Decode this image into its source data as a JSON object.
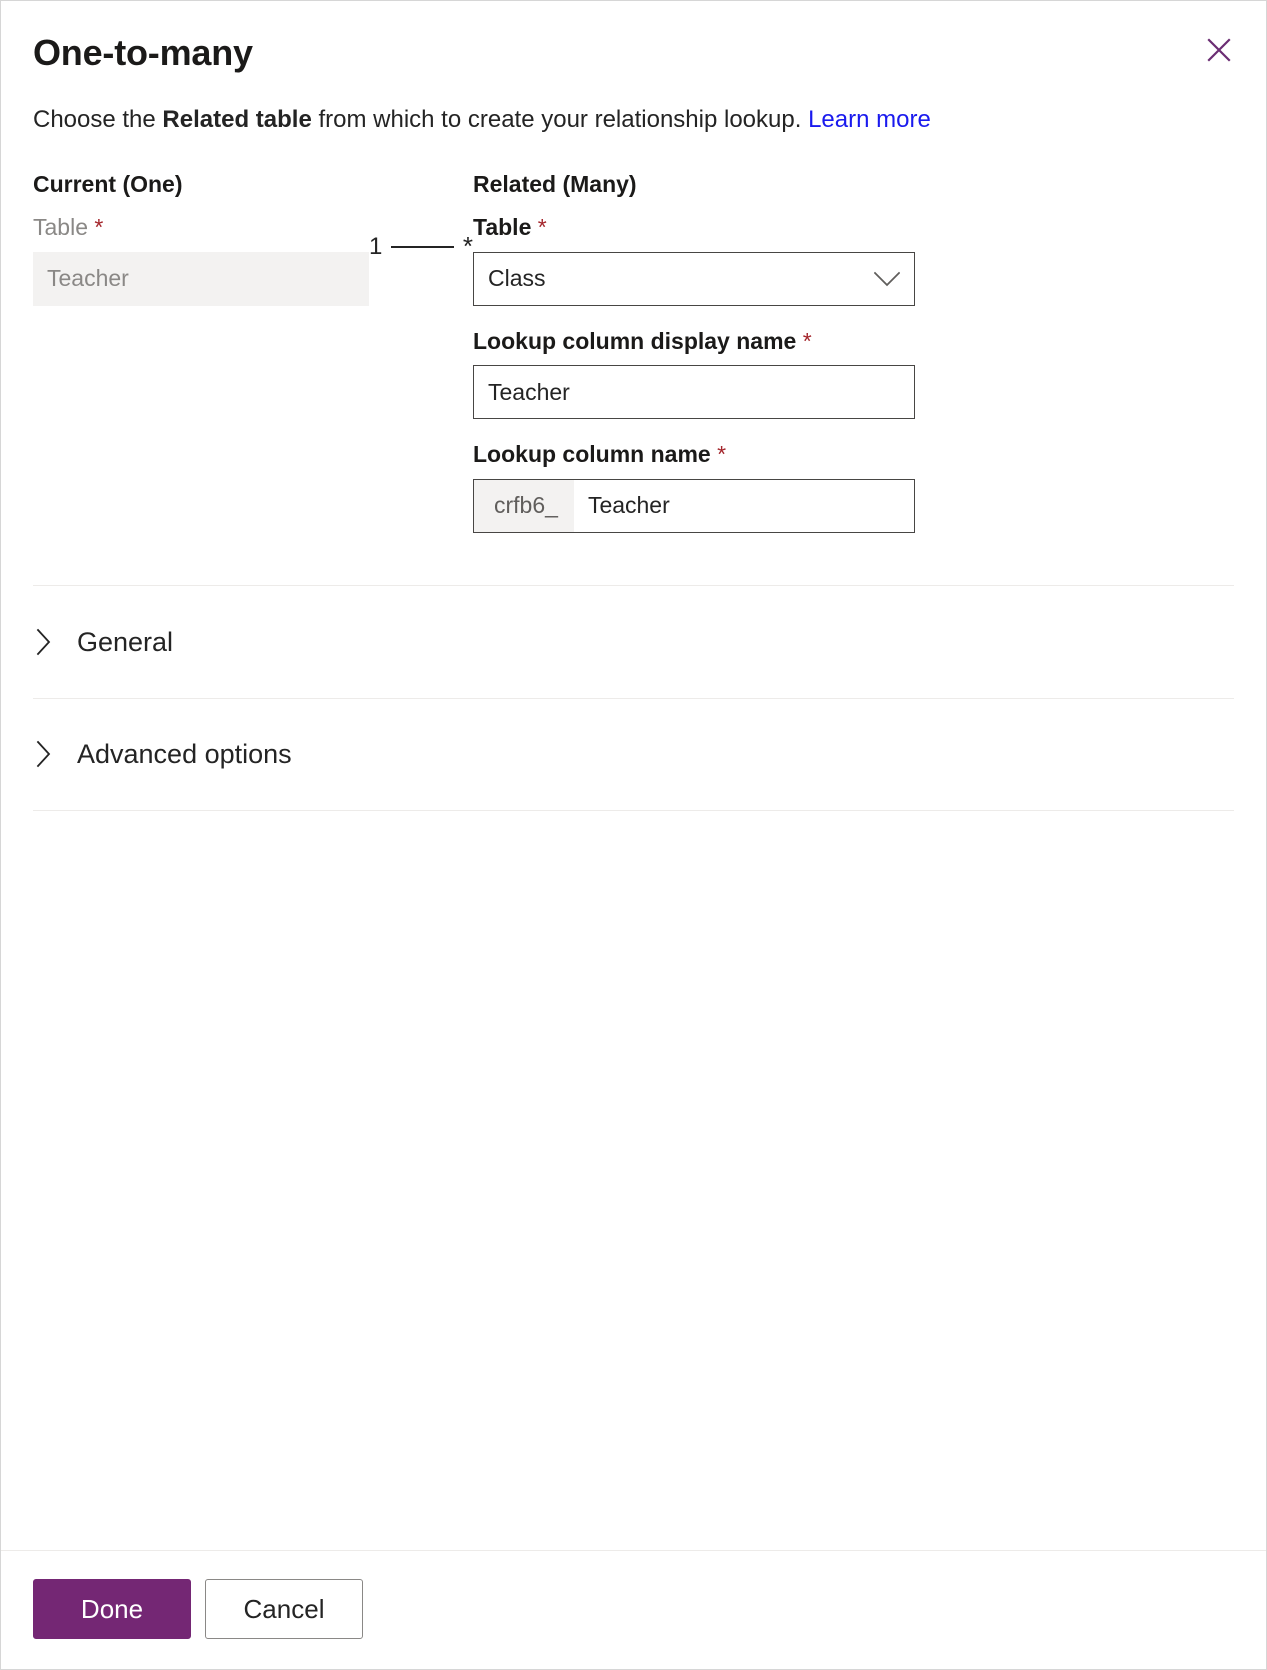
{
  "dialog": {
    "title": "One-to-many",
    "close_icon": "close-icon"
  },
  "intro": {
    "text_before": "Choose the ",
    "emphasis": "Related table",
    "text_after": " from which to create your relationship lookup. ",
    "link_label": "Learn more"
  },
  "current_column": {
    "heading": "Current (One)",
    "table_label": "Table",
    "required_mark": "*",
    "table_value": "Teacher"
  },
  "cardinality": {
    "one": "1",
    "many": "*"
  },
  "related_column": {
    "heading": "Related (Many)",
    "table_label": "Table",
    "table_required": "*",
    "table_value": "Class",
    "table_chevron_icon": "chevron-down-icon",
    "display_name_label": "Lookup column display name",
    "display_name_required": "*",
    "display_name_value": "Teacher",
    "column_name_label": "Lookup column name",
    "column_name_required": "*",
    "column_name_prefix": "crfb6_",
    "column_name_value": "Teacher"
  },
  "sections": [
    {
      "label": "General",
      "chevron_icon": "chevron-right-icon"
    },
    {
      "label": "Advanced options",
      "chevron_icon": "chevron-right-icon"
    }
  ],
  "footer": {
    "done_label": "Done",
    "cancel_label": "Cancel"
  },
  "colors": {
    "accent": "#742774",
    "link": "#1a1aee",
    "required": "#a4262c",
    "field_border": "#484644",
    "disabled_bg": "#f3f2f1",
    "divider": "#edebe9"
  }
}
